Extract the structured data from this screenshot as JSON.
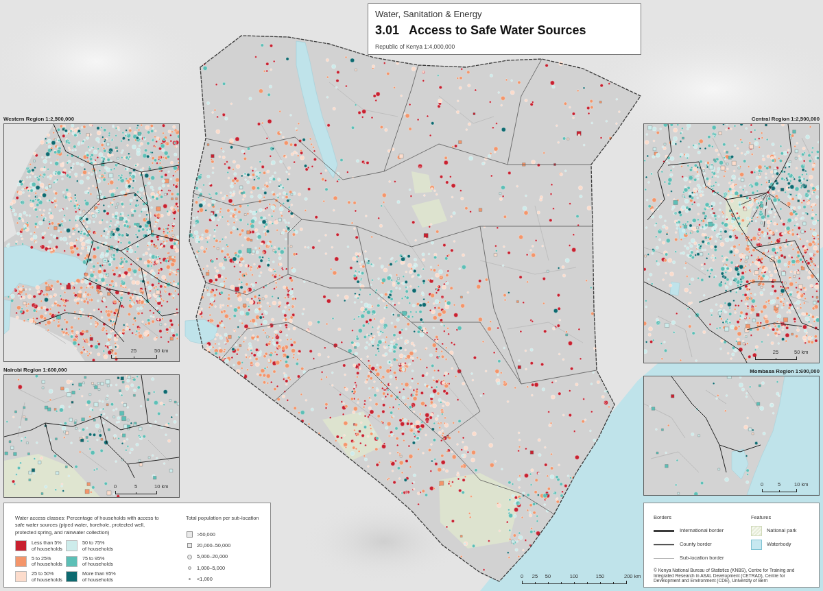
{
  "title_block": {
    "section": "Water, Sanitation & Energy",
    "number": "3.01",
    "title": "Access to Safe Water Sources",
    "scale": "Republic of Kenya 1:4,000,000"
  },
  "left_insets": [
    {
      "label": "Western Region 1:2,500,000",
      "kind": "western",
      "scale_labels": [
        "0",
        "25",
        "50 km"
      ]
    },
    {
      "label": "Nairobi Region 1:600,000",
      "kind": "nairobi",
      "scale_labels": [
        "0",
        "5",
        "10 km"
      ]
    }
  ],
  "right_insets": [
    {
      "label": "Central Region 1:2,500,000",
      "kind": "central",
      "scale_labels": [
        "25",
        "50 km"
      ]
    },
    {
      "label": "Mombasa Region 1:600,000",
      "kind": "mombasa",
      "scale_labels": [
        "0",
        "5",
        "10 km"
      ]
    }
  ],
  "scale_bar": {
    "labels": [
      "0",
      "25",
      "50",
      "100",
      "150",
      "200 km"
    ]
  },
  "legend_access": {
    "heading": "Water access classes: Percentage of households with access to safe water sources (piped water, borehole, protected well, protected spring, and rainwater collection)",
    "classes": [
      {
        "label": "Less than 5%\nof households",
        "color": "#c8202f"
      },
      {
        "label": "5 to 25%\nof households",
        "color": "#f4956a"
      },
      {
        "label": "25 to 50%\nof households",
        "color": "#fcdccc"
      },
      {
        "label": "50 to 75%\nof households",
        "color": "#cdeceb"
      },
      {
        "label": "75 to 95%\nof households",
        "color": "#5cbfb6"
      },
      {
        "label": "More than 95%\nof households",
        "color": "#0d6a70"
      }
    ]
  },
  "legend_population": {
    "heading": "Total population per sub-location",
    "items": [
      {
        "label": ">50,000",
        "kind": "bigsquare"
      },
      {
        "label": "20,000–50,000",
        "kind": "square"
      },
      {
        "label": "5,000–20,000",
        "kind": "bigcircle"
      },
      {
        "label": "1,000–5,000",
        "kind": "circle"
      },
      {
        "label": "<1,000",
        "kind": "dot"
      }
    ]
  },
  "legend_borders": {
    "heading": "Borders",
    "items": [
      {
        "label": "International border",
        "kind": "international"
      },
      {
        "label": "County border",
        "kind": "county"
      },
      {
        "label": "Sub-location border",
        "kind": "sublocation"
      }
    ]
  },
  "legend_features": {
    "heading": "Features",
    "items": [
      {
        "label": "National park",
        "kind": "park"
      },
      {
        "label": "Waterbody",
        "kind": "water"
      }
    ]
  },
  "credit": "© Kenya National Bureau of Statistics (KNBS), Centre for Training and Integrated Research in ASAL Development (CETRAD), Centre for Development and Environment (CDE), University of Bern"
}
